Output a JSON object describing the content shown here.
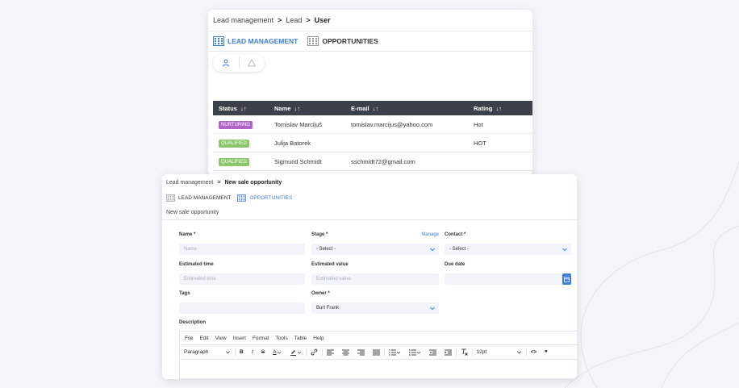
{
  "card1": {
    "breadcrumb": {
      "part1": "Lead management",
      "part2": "Lead",
      "current": "User",
      "separator": ">"
    },
    "tabs": [
      {
        "label": "LEAD MANAGEMENT",
        "icon": "building-icon",
        "active": true
      },
      {
        "label": "OPPORTUNITIES",
        "icon": "building-icon",
        "active": false
      }
    ],
    "segment": {
      "left_icon": "person-icon",
      "right_icon": "warning-icon"
    },
    "table": {
      "headers": {
        "status": "Status",
        "name": "Name",
        "email": "E-mail",
        "rating": "Rating",
        "sort_glyph": "↓↑"
      },
      "rows": [
        {
          "status": "NURTURING",
          "name": "Tomislav Marcijuš",
          "email": "tomislav.marcijus@yahoo.com",
          "rating": "Hot"
        },
        {
          "status": "QUALIFIED",
          "name": "Julija Batorek",
          "email": "",
          "rating": "HOT"
        },
        {
          "status": "QUALIFIED",
          "name": "Sigmund Schmidt",
          "email": "sschmidt72@gmail.com",
          "rating": ""
        }
      ]
    },
    "colors": {
      "accent": "#3d7fd9",
      "header_bg": "#3c4049",
      "nurturing": "#b065c6",
      "qualified": "#8cc66a"
    }
  },
  "card2": {
    "breadcrumb": {
      "part1": "Lead management",
      "current": "New sale opportunity",
      "separator": ">"
    },
    "tabs": [
      {
        "label": "LEAD MANAGEMENT",
        "active": false
      },
      {
        "label": "OPPORTUNITIES",
        "active": true
      }
    ],
    "title": "New sale opportunity",
    "form": {
      "name": {
        "label": "Name *",
        "placeholder": "Name"
      },
      "stage": {
        "label": "Stage *",
        "value": "- Select -",
        "manage": "Manage"
      },
      "contact": {
        "label": "Contact *",
        "value": "- Select -"
      },
      "estimated_time": {
        "label": "Estimated time",
        "placeholder": "Estimated time"
      },
      "estimated_value": {
        "label": "Estimated value",
        "placeholder": "Estimated value"
      },
      "due_date": {
        "label": "Due date",
        "placeholder": ""
      },
      "tags": {
        "label": "Tags",
        "placeholder": ""
      },
      "owner": {
        "label": "Owner *",
        "value": "Burt Frank"
      },
      "description": {
        "label": "Description"
      }
    },
    "editor": {
      "menu": [
        "File",
        "Edit",
        "View",
        "Insert",
        "Format",
        "Tools",
        "Table",
        "Help"
      ],
      "paragraph": "Paragraph",
      "bold": "B",
      "italic": "I",
      "strike": "S",
      "font_color": "A",
      "font_size": "12pt",
      "code": "<>",
      "quote": "❞"
    }
  }
}
